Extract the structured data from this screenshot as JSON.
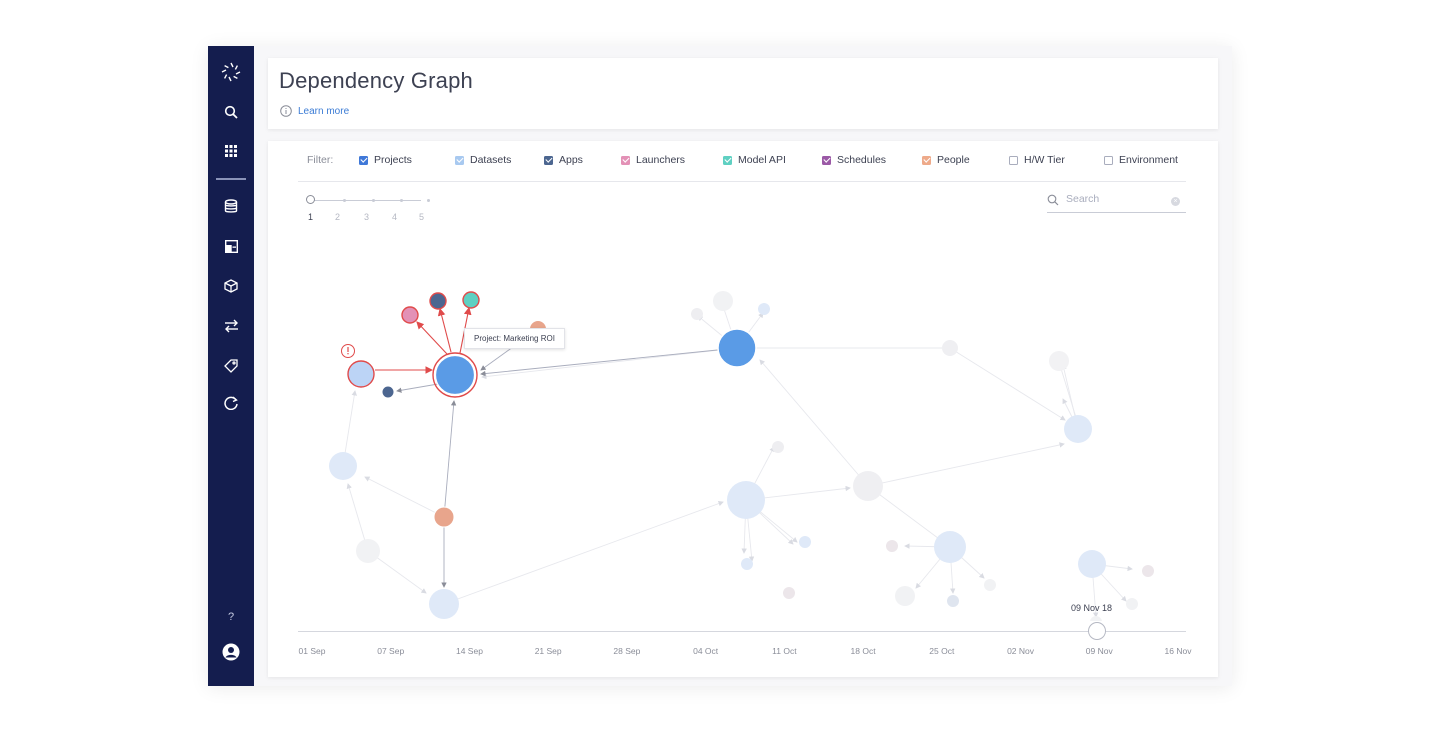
{
  "sidebar": {
    "top_icons": [
      "logo-icon",
      "search-icon",
      "apps-grid-icon"
    ],
    "nav_icons": [
      "database-icon",
      "workspace-icon",
      "cube-icon",
      "swap-arrows-icon",
      "tag-icon",
      "refresh-icon"
    ],
    "help_label": "?",
    "bottom_icon": "user-avatar-icon"
  },
  "header": {
    "title": "Dependency Graph",
    "learn_more": "Learn more"
  },
  "filters": {
    "label": "Filter:",
    "items": [
      {
        "label": "Projects",
        "checked": true,
        "color": "#3f78d8"
      },
      {
        "label": "Datasets",
        "checked": true,
        "color": "#a8c9f0"
      },
      {
        "label": "Apps",
        "checked": true,
        "color": "#4c6690"
      },
      {
        "label": "Launchers",
        "checked": true,
        "color": "#e391b6"
      },
      {
        "label": "Model API",
        "checked": true,
        "color": "#5fd0c2"
      },
      {
        "label": "Schedules",
        "checked": true,
        "color": "#9b59a6"
      },
      {
        "label": "People",
        "checked": true,
        "color": "#eeaa8a"
      },
      {
        "label": "H/W Tier",
        "checked": false,
        "color": "#ffffff"
      },
      {
        "label": "Environment",
        "checked": false,
        "color": "#ffffff"
      }
    ]
  },
  "depth": {
    "labels": [
      "1",
      "2",
      "3",
      "4",
      "5"
    ],
    "selected": "1"
  },
  "search": {
    "placeholder": "Search"
  },
  "tooltip": {
    "text": "Project: Marketing ROI"
  },
  "timeline": {
    "current_label": "09 Nov 18",
    "ticks": [
      "01 Sep",
      "07 Sep",
      "14 Sep",
      "21 Sep",
      "28 Sep",
      "04 Oct",
      "11 Oct",
      "18 Oct",
      "25 Oct",
      "02 Nov",
      "09 Nov",
      "16 Nov"
    ]
  },
  "colors": {
    "sidebar_bg": "#141d4e",
    "highlight_edge": "#e04b4b",
    "project": "#5a9be6",
    "faded_node": "#dfe9f8",
    "person": "#e8a58c"
  }
}
